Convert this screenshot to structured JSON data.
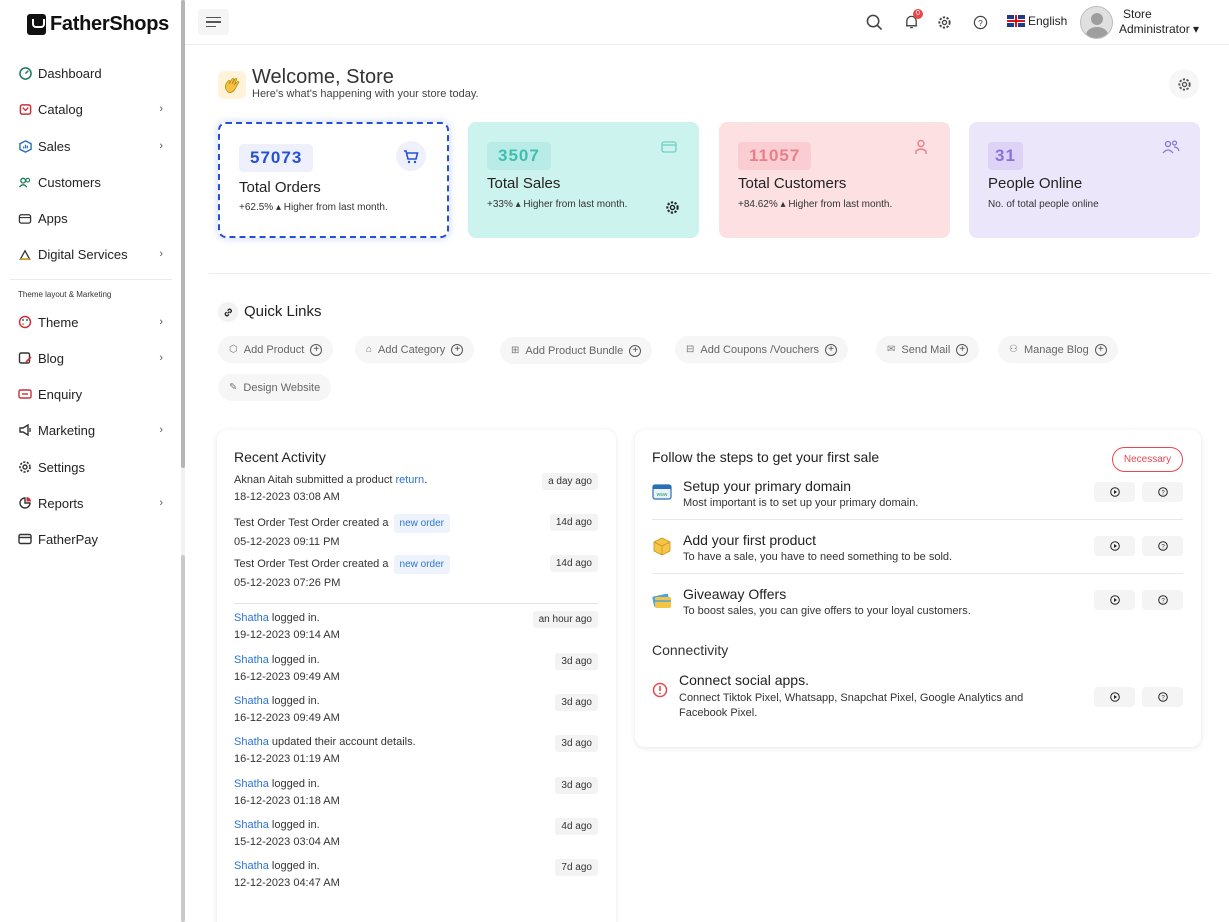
{
  "app": {
    "name": "FatherShops"
  },
  "sidebar": {
    "items": [
      {
        "label": "Dashboard",
        "icon": "dashboard-icon",
        "chevron": false
      },
      {
        "label": "Catalog",
        "icon": "catalog-icon",
        "chevron": true
      },
      {
        "label": "Sales",
        "icon": "sales-icon",
        "chevron": true
      },
      {
        "label": "Customers",
        "icon": "customers-icon",
        "chevron": false
      },
      {
        "label": "Apps",
        "icon": "apps-icon",
        "chevron": false
      },
      {
        "label": "Digital Services",
        "icon": "digital-services-icon",
        "chevron": true
      }
    ],
    "section_label": "Theme layout & Marketing",
    "items2": [
      {
        "label": "Theme",
        "icon": "theme-icon",
        "chevron": true
      },
      {
        "label": "Blog",
        "icon": "blog-icon",
        "chevron": true
      },
      {
        "label": "Enquiry",
        "icon": "enquiry-icon",
        "chevron": false
      },
      {
        "label": "Marketing",
        "icon": "marketing-icon",
        "chevron": true
      },
      {
        "label": "Settings",
        "icon": "settings-icon",
        "chevron": false
      },
      {
        "label": "Reports",
        "icon": "reports-icon",
        "chevron": true
      },
      {
        "label": "FatherPay",
        "icon": "fatherpay-icon",
        "chevron": false
      }
    ]
  },
  "topbar": {
    "notifications_count": "0",
    "language": "English",
    "user_line1": "Store",
    "user_line2": "Administrator ▾"
  },
  "welcome": {
    "title": "Welcome, Store",
    "subtitle": "Here's what's happening with your store today."
  },
  "stats": [
    {
      "value": "57073",
      "title": "Total Orders",
      "sub": "+62.5% ▴ Higher from last month.",
      "color": "#2550d6",
      "bg": "#eef1fb"
    },
    {
      "value": "3507",
      "title": "Total Sales",
      "sub": "+33% ▴ Higher from last month.",
      "color": "#3fbfb0",
      "bg": "#b9ece6"
    },
    {
      "value": "11057",
      "title": "Total Customers",
      "sub": "+84.62% ▴ Higher from last month.",
      "color": "#e8808a",
      "bg": "#f9cdd1"
    },
    {
      "value": "31",
      "title": "People Online",
      "sub": "No. of total people online",
      "color": "#8a72d8",
      "bg": "#ddd3f7"
    }
  ],
  "quick_links": {
    "title": "Quick Links",
    "items": [
      "Add Product",
      "Add Category",
      "Add Product Bundle",
      "Add Coupons /Vouchers",
      "Send Mail",
      "Manage Blog",
      "Design Website"
    ]
  },
  "recent_activity": {
    "title": "Recent Activity",
    "items": [
      {
        "pre": "Aknan Aitah submitted a product ",
        "link": "return",
        "post": ".",
        "tag": "",
        "date": "18-12-2023 03:08 AM",
        "ago": "a day ago"
      },
      {
        "pre": "Test Order Test Order created a ",
        "link": "",
        "post": "",
        "tag": "new order",
        "date": "05-12-2023 09:11 PM",
        "ago": "14d ago"
      },
      {
        "pre": "Test Order Test Order created a ",
        "link": "",
        "post": "",
        "tag": "new order",
        "date": "05-12-2023 07:26 PM",
        "ago": "14d ago"
      },
      {
        "pre": "",
        "link": "Shatha",
        "post": " logged in.",
        "tag": "",
        "date": "19-12-2023 09:14 AM",
        "ago": "an hour ago"
      },
      {
        "pre": "",
        "link": "Shatha",
        "post": " logged in.",
        "tag": "",
        "date": "16-12-2023 09:49 AM",
        "ago": "3d ago"
      },
      {
        "pre": "",
        "link": "Shatha",
        "post": " logged in.",
        "tag": "",
        "date": "16-12-2023 09:49 AM",
        "ago": "3d ago"
      },
      {
        "pre": "",
        "link": "Shatha",
        "post": " updated their account details.",
        "tag": "",
        "date": "16-12-2023 01:19 AM",
        "ago": "3d ago"
      },
      {
        "pre": "",
        "link": "Shatha",
        "post": " logged in.",
        "tag": "",
        "date": "16-12-2023 01:18 AM",
        "ago": "3d ago"
      },
      {
        "pre": "",
        "link": "Shatha",
        "post": " logged in.",
        "tag": "",
        "date": "15-12-2023 03:04 AM",
        "ago": "4d ago"
      },
      {
        "pre": "",
        "link": "Shatha",
        "post": " logged in.",
        "tag": "",
        "date": "12-12-2023 04:47 AM",
        "ago": "7d ago"
      }
    ]
  },
  "first_sale": {
    "title": "Follow the steps to get your first sale",
    "badge": "Necessary",
    "steps": [
      {
        "title": "Setup your primary domain",
        "desc": "Most important is to set up your primary domain.",
        "icon": "domain-icon"
      },
      {
        "title": "Add your first product",
        "desc": "To have a sale, you have to need something to be sold.",
        "icon": "box-icon"
      },
      {
        "title": "Giveaway Offers",
        "desc": "To boost sales, you can give offers to your loyal customers.",
        "icon": "gift-card-icon"
      }
    ],
    "connectivity_title": "Connectivity",
    "connect": {
      "title": "Connect social apps.",
      "desc": "Connect Tiktok Pixel, Whatsapp, Snapchat Pixel, Google Analytics and Facebook Pixel."
    }
  }
}
